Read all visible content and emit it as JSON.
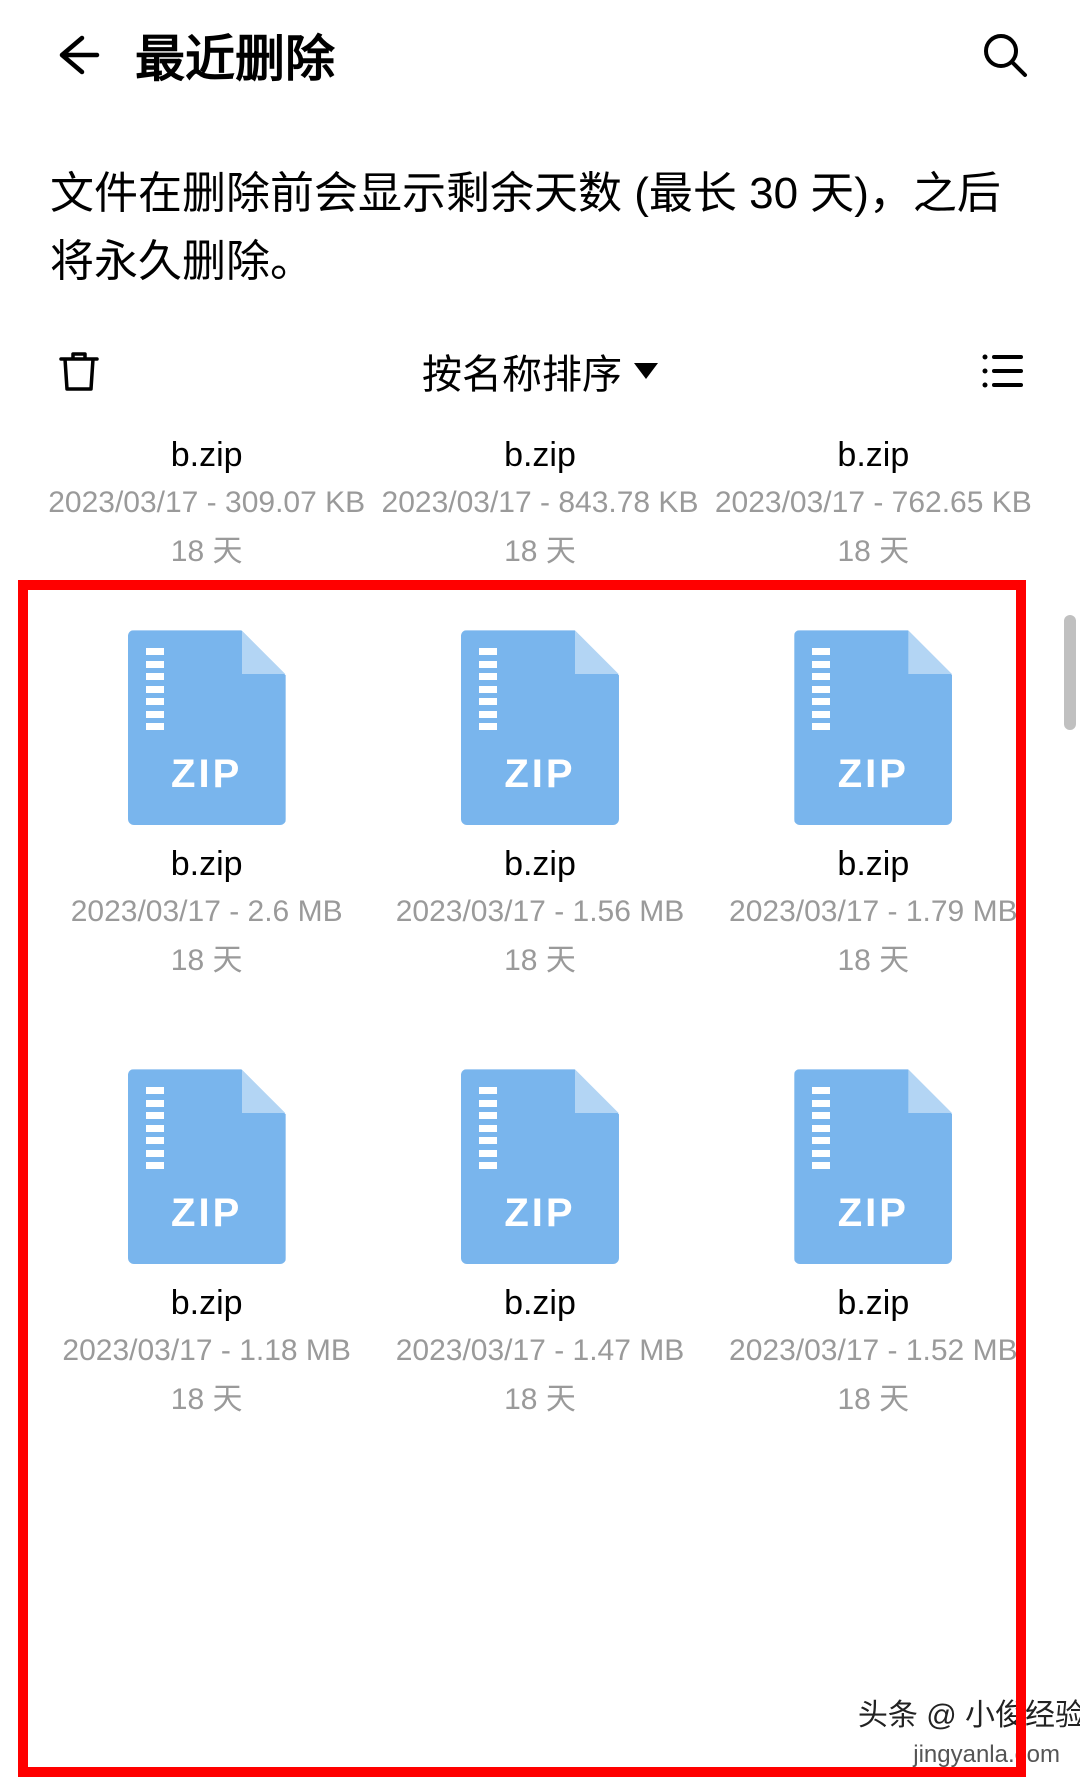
{
  "header": {
    "title": "最近删除"
  },
  "description": "文件在删除前会显示剩余天数 (最长 30 天)，之后将永久删除。",
  "toolbar": {
    "sort_label": "按名称排序"
  },
  "top_info": [
    {
      "name": "b.zip",
      "meta": "2023/03/17 - 309.07 KB",
      "days": "18 天"
    },
    {
      "name": "b.zip",
      "meta": "2023/03/17 - 843.78 KB",
      "days": "18 天"
    },
    {
      "name": "b.zip",
      "meta": "2023/03/17 - 762.65 KB",
      "days": "18 天"
    }
  ],
  "grid": [
    [
      {
        "name": "b.zip",
        "meta": "2023/03/17 - 2.6 MB",
        "days": "18 天",
        "icon_label": "ZIP"
      },
      {
        "name": "b.zip",
        "meta": "2023/03/17 - 1.56 MB",
        "days": "18 天",
        "icon_label": "ZIP"
      },
      {
        "name": "b.zip",
        "meta": "2023/03/17 - 1.79 MB",
        "days": "18 天",
        "icon_label": "ZIP"
      }
    ],
    [
      {
        "name": "b.zip",
        "meta": "2023/03/17 - 1.18 MB",
        "days": "18 天",
        "icon_label": "ZIP"
      },
      {
        "name": "b.zip",
        "meta": "2023/03/17 - 1.47 MB",
        "days": "18 天",
        "icon_label": "ZIP"
      },
      {
        "name": "b.zip",
        "meta": "2023/03/17 - 1.52 MB",
        "days": "18 天",
        "icon_label": "ZIP"
      }
    ]
  ],
  "watermark": {
    "top": "头条 @ 小俊经验啦",
    "bottom": "jingyanla.com"
  }
}
